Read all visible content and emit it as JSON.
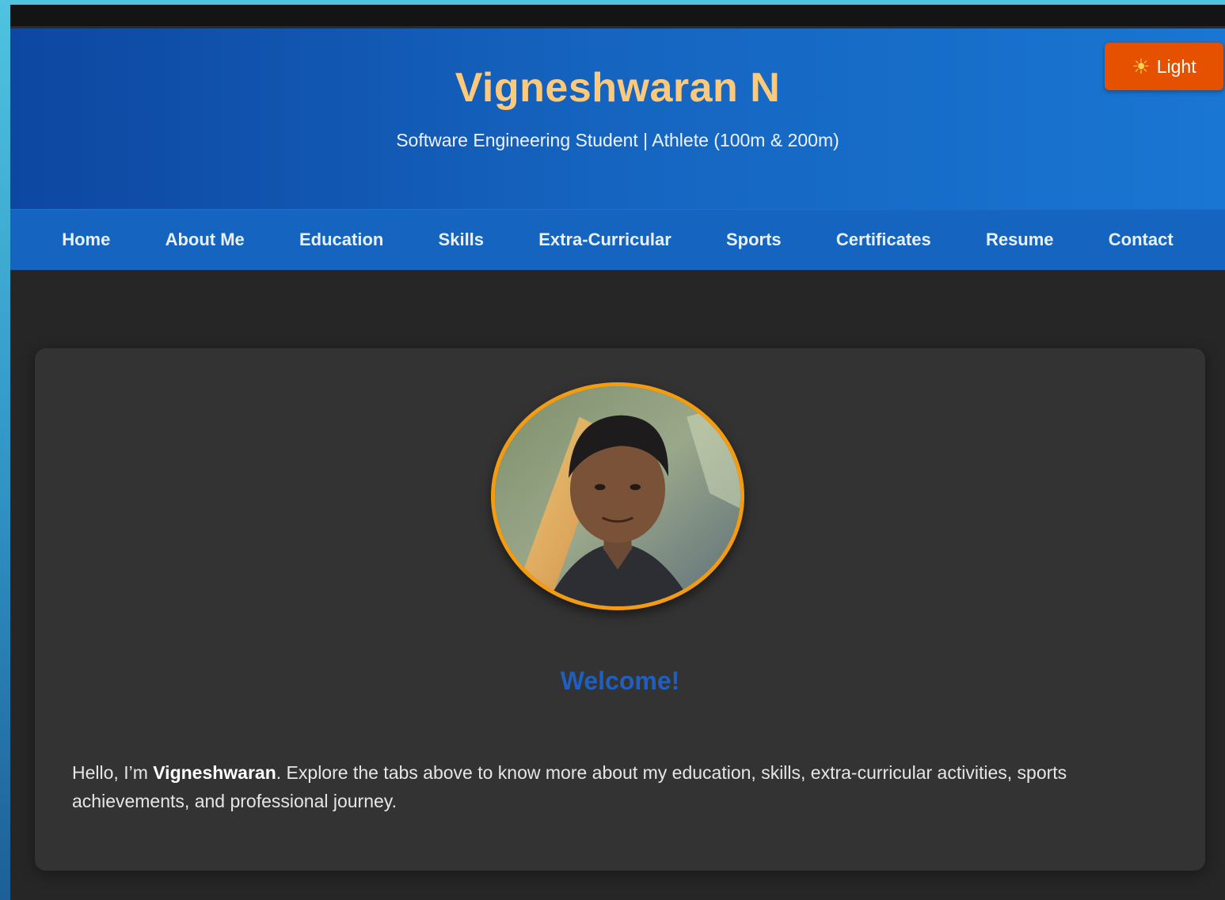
{
  "header": {
    "title": "Vigneshwaran N",
    "subtitle": "Software Engineering Student | Athlete (100m & 200m)",
    "theme_toggle": {
      "icon": "sun-icon",
      "glyph": "☀",
      "label": "Light"
    }
  },
  "nav": {
    "items": [
      {
        "label": "Home"
      },
      {
        "label": "About Me"
      },
      {
        "label": "Education"
      },
      {
        "label": "Skills"
      },
      {
        "label": "Extra-Curricular"
      },
      {
        "label": "Sports"
      },
      {
        "label": "Certificates"
      },
      {
        "label": "Resume"
      },
      {
        "label": "Contact"
      }
    ]
  },
  "main": {
    "welcome_heading": "Welcome!",
    "intro": {
      "prefix": "Hello, I’m ",
      "name": "Vigneshwaran",
      "suffix": ". Explore the tabs above to know more about my education, skills, extra-curricular activities, sports achievements, and professional journey."
    }
  },
  "colors": {
    "header_blue": "#1565c0",
    "title_gold": "#ffc97a",
    "toggle_orange": "#e65100",
    "avatar_border": "#f39c12",
    "welcome_blue": "#1e5fbf",
    "card_bg": "#333333",
    "page_bg": "#262626"
  }
}
